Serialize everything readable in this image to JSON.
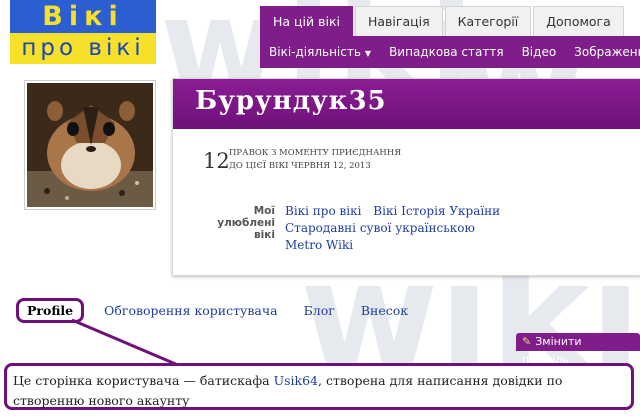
{
  "logo": {
    "line1": "Вікі",
    "line2": "про вікі"
  },
  "nav": {
    "tabs": [
      {
        "label": "На цій вікі",
        "active": true
      },
      {
        "label": "Навігація",
        "active": false
      },
      {
        "label": "Категорії",
        "active": false
      },
      {
        "label": "Допомога",
        "active": false
      }
    ],
    "subnav": [
      "Вікі-діяльність",
      "Випадкова стаття",
      "Відео",
      "Зображення"
    ]
  },
  "profile": {
    "username": "Бурундук35",
    "edits_count": "12",
    "edits_line1": "правок з моменту приєднання",
    "edits_line2": "до цієї вікі червня 12, 2013",
    "favorites_label": "Мої улюблені вікі",
    "favorites": [
      "Вікі про вікі",
      "Вікі Історія України",
      "Стародавні сувої українською",
      "Metro Wiki"
    ]
  },
  "profile_tabs": [
    {
      "label": "Profile",
      "active": true
    },
    {
      "label": "Обговорення користувача",
      "active": false
    },
    {
      "label": "Блог",
      "active": false
    },
    {
      "label": "Внесок",
      "active": false
    }
  ],
  "edit_button": {
    "label": "Змінити профіль",
    "icon": "pencil-icon"
  },
  "description": {
    "before": "Це сторінка користувача — батискафа ",
    "link": "Usik64",
    "after": ", створена для написання довідки по створенню нового акаунту"
  },
  "colors": {
    "accent": "#7f1d8a",
    "link": "#1d3e9e",
    "logo_blue": "#2b5fd1",
    "logo_yellow": "#f6e02a"
  }
}
